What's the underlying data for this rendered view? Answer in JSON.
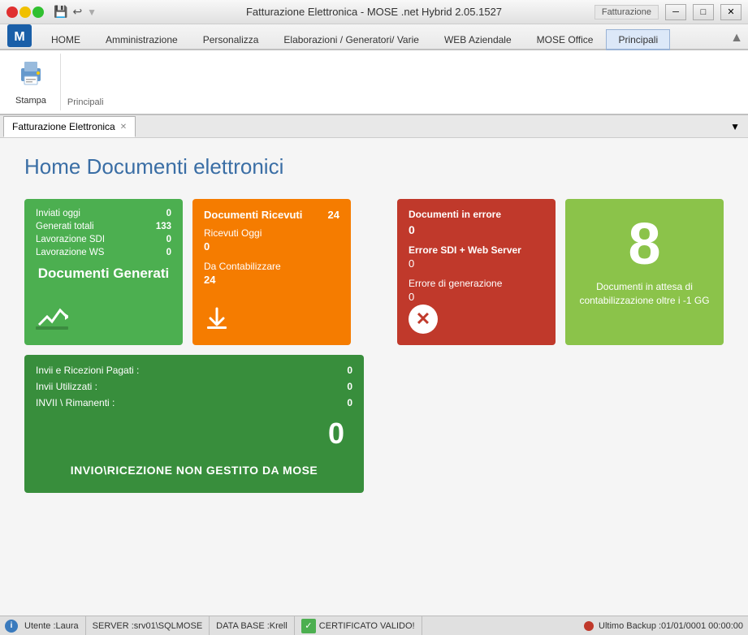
{
  "titlebar": {
    "title": "Fatturazione Elettronica - MOSE .net Hybrid 2.05.1527",
    "right_label": "Fatturazione"
  },
  "ribbon": {
    "tabs": [
      {
        "id": "home",
        "label": "HOME"
      },
      {
        "id": "amministrazione",
        "label": "Amministrazione"
      },
      {
        "id": "personalizza",
        "label": "Personalizza"
      },
      {
        "id": "elaborazioni",
        "label": "Elaborazioni / Generatori/ Varie"
      },
      {
        "id": "web",
        "label": "WEB Aziendale"
      },
      {
        "id": "mose",
        "label": "MOSE Office"
      },
      {
        "id": "principali",
        "label": "Principali",
        "active": true
      }
    ],
    "buttons": [
      {
        "id": "stampa",
        "label": "Stampa",
        "icon": "🖨"
      }
    ],
    "section_label": "Principali"
  },
  "doc_tabs": [
    {
      "id": "fatturazione",
      "label": "Fatturazione Elettronica",
      "closable": true
    }
  ],
  "main": {
    "title": "Home Documenti elettronici",
    "cards": {
      "green": {
        "rows": [
          {
            "label": "Inviati oggi",
            "value": "0"
          },
          {
            "label": "Generati totali",
            "value": "133"
          },
          {
            "label": "Lavorazione SDI",
            "value": "0"
          },
          {
            "label": "Lavorazione WS",
            "value": "0"
          }
        ],
        "big_label": "Documenti Generati"
      },
      "orange": {
        "title": "Documenti Ricevuti",
        "title_value": "24",
        "row1_label": "Ricevuti Oggi",
        "row1_value": "0",
        "row2_label": "Da Contabilizzare",
        "row2_value": "24"
      },
      "red": {
        "title": "Documenti in errore",
        "title_value": "0",
        "row1_label": "Errore SDI + Web Server",
        "row1_value": "0",
        "row2_label": "Errore di generazione",
        "row2_value": "0"
      },
      "yellow": {
        "big_number": "8",
        "sub_text": "Documenti in attesa di contabilizzazione oltre i -1 GG"
      }
    },
    "bottom_card": {
      "row1_label": "Invii e Ricezioni Pagati :",
      "row1_value": "0",
      "row2_label": "Invii Utilizzati :",
      "row2_value": "0",
      "row3_label": "INVII \\ Rimanenti :",
      "row3_value": "0",
      "big_number": "0",
      "footer": "INVIO\\RICEZIONE NON GESTITO DA MOSE"
    }
  },
  "statusbar": {
    "info_label": "Utente :Laura",
    "server": "SERVER :srv01\\SQLMOSE",
    "database": "DATA BASE :Krell",
    "cert": "CERTIFICATO VALIDO!",
    "backup": "Ultimo Backup :01/01/0001 00:00:00"
  }
}
